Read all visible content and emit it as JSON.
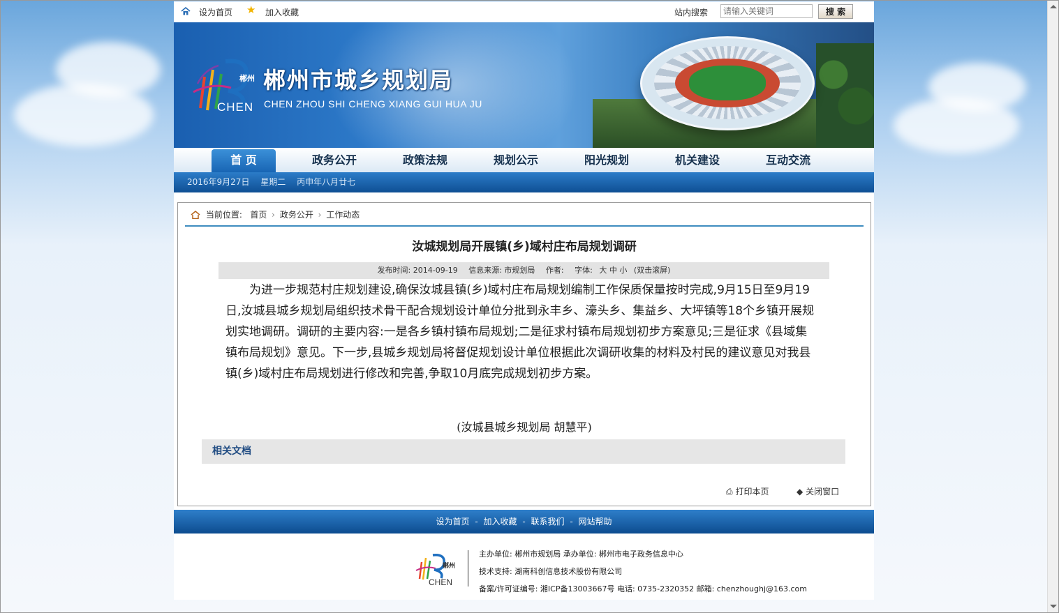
{
  "topbar": {
    "set_home": "设为首页",
    "add_favorite": "加入收藏",
    "search_label": "站内搜索",
    "search_placeholder": "请输入关键词",
    "search_button": "搜 索"
  },
  "banner": {
    "title": "郴州市城乡规划局",
    "subtitle": "CHEN ZHOU SHI CHENG XIANG GUI HUA JU",
    "logo_cn": "郴州",
    "logo_en": "CHEN"
  },
  "nav": {
    "items": [
      "首 页",
      "政务公开",
      "政策法规",
      "规划公示",
      "阳光规划",
      "机关建设",
      "互动交流"
    ]
  },
  "datebar": {
    "date": "2016年9月27日",
    "weekday": "星期二",
    "lunar": "丙申年八月廿七"
  },
  "breadcrumb": {
    "label": "当前位置:",
    "items": [
      "首页",
      "政务公开",
      "工作动态"
    ]
  },
  "article": {
    "title": "汝城规划局开展镇(乡)域村庄布局规划调研",
    "publish_time": "发布时间: 2014-09-19",
    "source": "信息来源: 市规划局",
    "author": "作者:",
    "font_label": "字体:",
    "font_large": "大",
    "font_medium": "中",
    "font_small": "小",
    "scroll_hint": "(双击滚屏)",
    "body": "为进一步规范村庄规划建设,确保汝城县镇(乡)域村庄布局规划编制工作保质保量按时完成,9月15日至9月19日,汝城县城乡规划局组织技术骨干配合规划设计单位分批到永丰乡、濠头乡、集益乡、大坪镇等18个乡镇开展规划实地调研。调研的主要内容:一是各乡镇村镇布局规划;二是征求村镇布局规划初步方案意见;三是征求《县域集镇布局规划》意见。下一步,县城乡规划局将督促规划设计单位根据此次调研收集的材料及村民的建议意见对我县镇(乡)域村庄布局规划进行修改和完善,争取10月底完成规划初步方案。",
    "signature": "(汝城县城乡规划局  胡慧平)",
    "related": "相关文档",
    "print": "打印本页",
    "close": "关闭窗口"
  },
  "footer": {
    "links": [
      "设为首页",
      "加入收藏",
      "联系我们",
      "网站帮助"
    ],
    "separator": "-",
    "line1": "主办单位: 郴州市规划局  承办单位: 郴州市电子政务信息中心",
    "line2": "技术支持: 湖南科创信息技术股份有限公司",
    "line3": "备案/许可证编号: 湘ICP备13003667号  电话: 0735-2320352  邮箱: chenzhoughj@163.com",
    "logo_cn": "郴州",
    "logo_en": "CHEN"
  },
  "colors": {
    "nav_active": "#1f74c2",
    "nav_text": "#17324f",
    "datebar": "#1a5fa8",
    "crumb_line": "#3e8cbf",
    "related_text": "#1f4b82"
  }
}
